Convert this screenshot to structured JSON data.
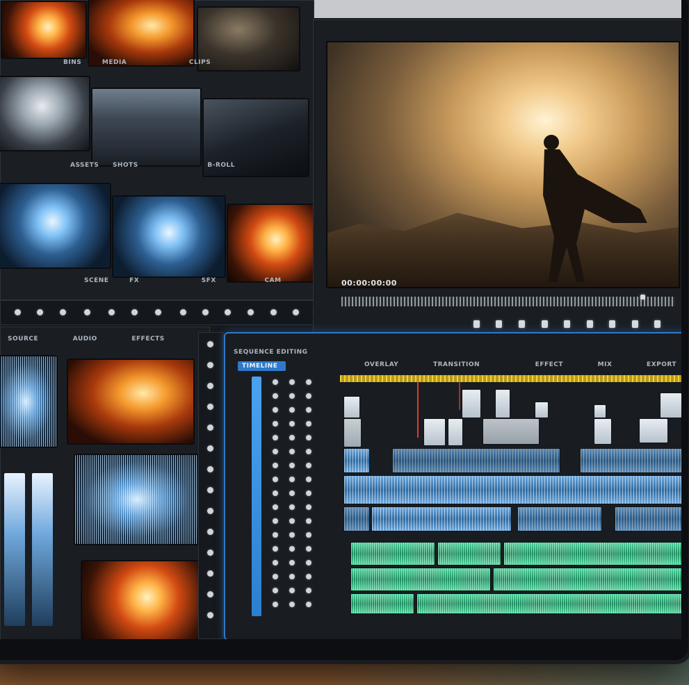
{
  "media_bin": {
    "caps_row1": [
      "BINS",
      "MEDIA",
      "CLIPS"
    ],
    "caps_row2": [
      "ASSETS",
      "SHOTS",
      "B-ROLL"
    ],
    "caps_row3": [
      "SCENE",
      "FX",
      "SFX",
      "CAM"
    ],
    "toolbar_icons": [
      "play-icon",
      "pause-icon",
      "stop-icon",
      "loop-icon",
      "marker-icon",
      "in-point-icon",
      "out-point-icon",
      "trim-icon",
      "ripple-icon",
      "razor-icon",
      "zoom-icon",
      "snap-icon",
      "link-icon",
      "lock-icon"
    ]
  },
  "preview": {
    "timecode": "00:00:00:00",
    "transport_icons": [
      "rewind-icon",
      "step-back-icon",
      "play-icon",
      "pause-icon",
      "step-forward-icon",
      "fast-forward-icon",
      "loop-icon",
      "mark-in-icon",
      "mark-out-icon",
      "export-icon"
    ]
  },
  "left_bottom": {
    "header": [
      "SOURCE",
      "AUDIO",
      "EFFECTS"
    ]
  },
  "timeline": {
    "panel_title": "SEQUENCE EDITING",
    "active_tab": "TIMELINE",
    "header_labels": [
      "OVERLAY",
      "TRANSITION",
      "EFFECT",
      "MIX",
      "EXPORT"
    ],
    "track_controls_rows": 17
  },
  "colors": {
    "accent_blue": "#2f79c8",
    "ruler_yellow": "#f4d233",
    "playhead_red": "#e03b2a",
    "audio_green": "#1d8a5e",
    "audio_blue": "#2e6aa0"
  }
}
